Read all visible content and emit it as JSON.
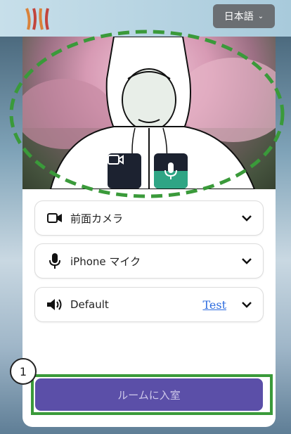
{
  "header": {
    "language_label": "日本語"
  },
  "preview": {
    "camera_toggle_icon": "video-camera-icon",
    "mic_toggle_icon": "microphone-icon",
    "mic_level": 0.5
  },
  "devices": [
    {
      "icon": "video-camera-icon",
      "label": "前面カメラ"
    },
    {
      "icon": "microphone-icon",
      "label": "iPhone マイク"
    },
    {
      "icon": "speaker-icon",
      "label": "Default",
      "test_label": "Test"
    }
  ],
  "actions": {
    "enter_room_label": "ルームに入室"
  },
  "annotation": {
    "step_number": "1"
  },
  "colors": {
    "accent": "#5b4fa8",
    "annotation_green": "#3a9a3a",
    "mic_level_green": "#2fa585",
    "language_button": "#6b6f73"
  }
}
